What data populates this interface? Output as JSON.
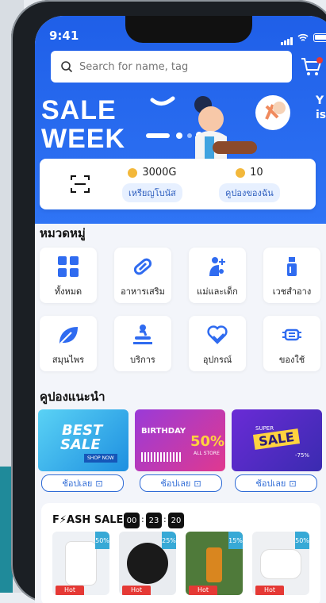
{
  "status_bar": {
    "time": "9:41"
  },
  "search": {
    "placeholder": "Search for name, tag"
  },
  "banner": {
    "line1": "SALE",
    "line2": "WEEK",
    "side_text": "Y\nis c"
  },
  "wallet": {
    "items": [
      {
        "value": "3000G",
        "label": "เหรียญโบนัส"
      },
      {
        "value": "10",
        "label": "คูปองของฉัน"
      }
    ]
  },
  "categories": {
    "title": "หมวดหมู่",
    "items": [
      {
        "label": "ทั้งหมด",
        "icon": "grid-icon"
      },
      {
        "label": "อาหารเสริม",
        "icon": "pill-icon"
      },
      {
        "label": "แม่และเด็ก",
        "icon": "mother-child-icon"
      },
      {
        "label": "เวชสำอาง",
        "icon": "cosmetic-bottle-icon"
      },
      {
        "label": "สมุนไพร",
        "icon": "leaf-icon"
      },
      {
        "label": "บริการ",
        "icon": "massage-service-icon"
      },
      {
        "label": "อุปกรณ์",
        "icon": "heart-hand-icon"
      },
      {
        "label": "ของใช้",
        "icon": "face-mask-icon"
      }
    ]
  },
  "coupons": {
    "title": "คูปองแนะนำ",
    "items": [
      {
        "text1": "BEST",
        "text2": "SALE",
        "text3": "SHOP NOW",
        "button": "ช้อปเลย"
      },
      {
        "text1": "BIRTHDAY",
        "text2": "50%",
        "text3": "ALL STORE",
        "button": "ช้อปเลย"
      },
      {
        "text1": "SUPER",
        "text2": "SALE",
        "text3": "-75%",
        "button": "ช้อปเลย"
      }
    ]
  },
  "flash_sale": {
    "title": "F⚡ASH SALE",
    "timer": [
      "00",
      "23",
      "20"
    ],
    "products": [
      {
        "discount": "50%",
        "badge": "Hot"
      },
      {
        "discount": "25%",
        "badge": "Hot"
      },
      {
        "discount": "15%",
        "badge": "Hot"
      },
      {
        "discount": "50%",
        "badge": "Hot"
      }
    ]
  },
  "colors": {
    "primary": "#2f6bf0",
    "accent": "#e53935",
    "coin": "#f3b83b"
  }
}
